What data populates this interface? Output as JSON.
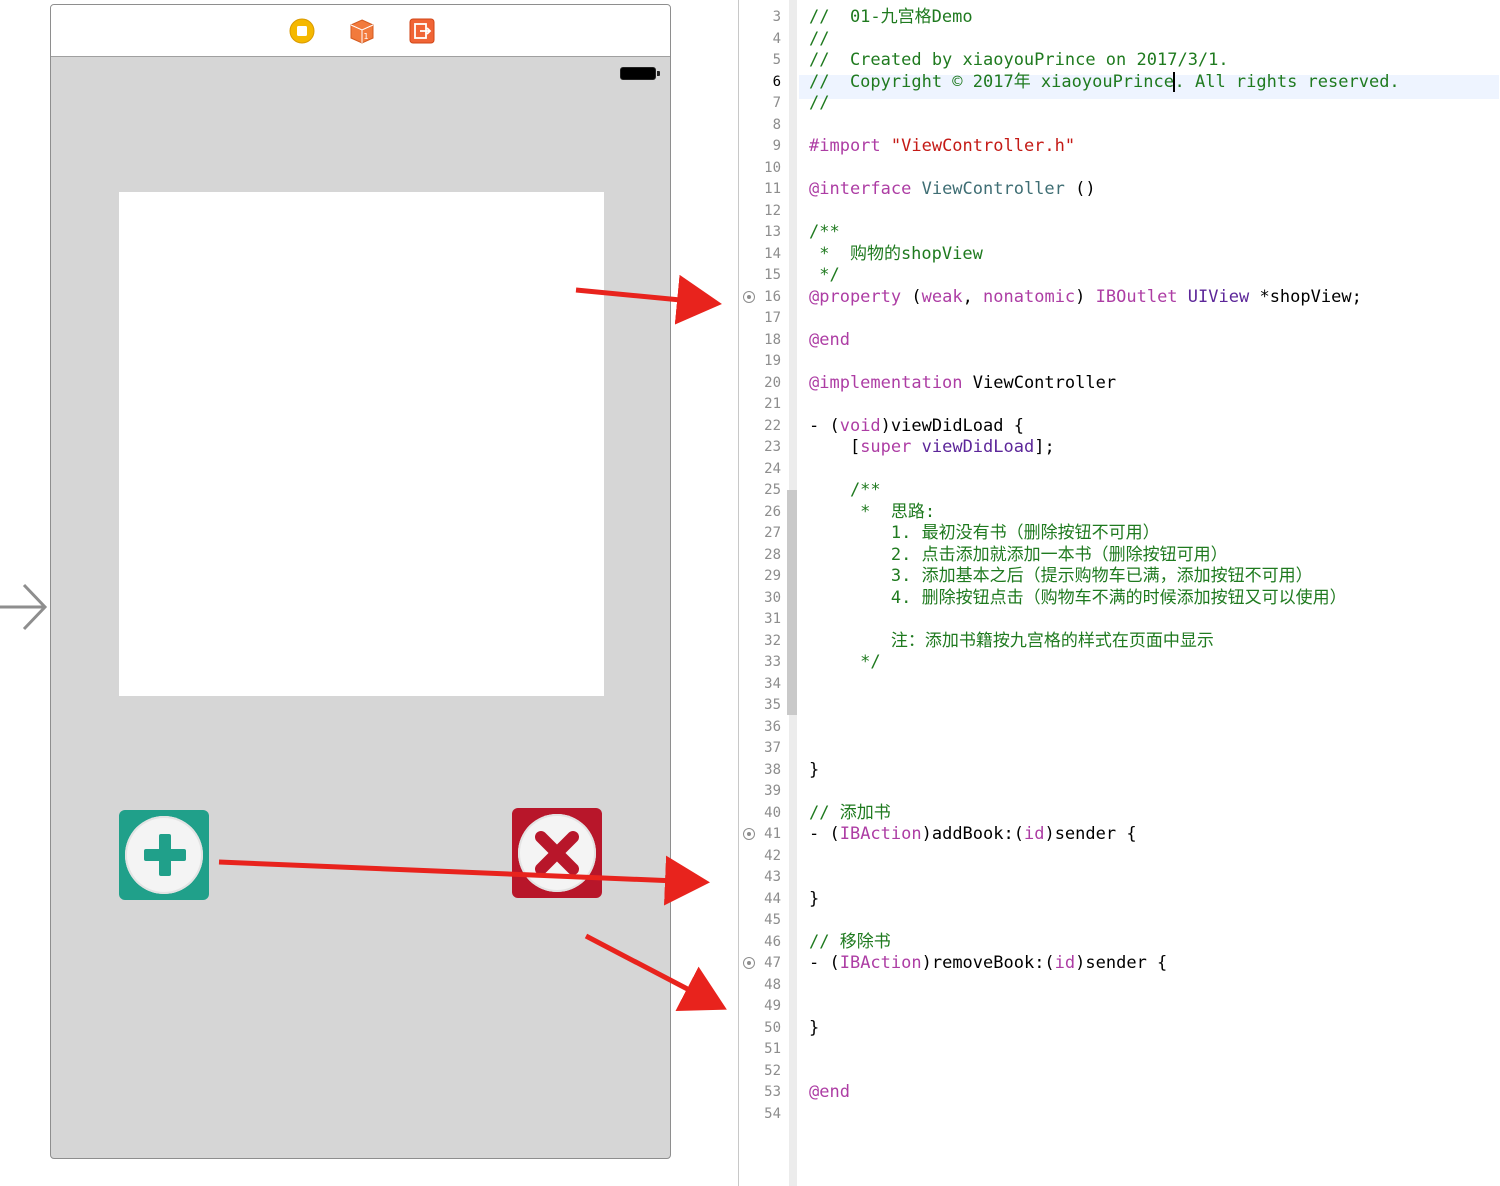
{
  "storyboard": {
    "dock_icons": [
      "view-controller-icon",
      "first-responder-icon",
      "exit-icon"
    ],
    "buttons": {
      "add": {
        "icon": "plus-icon",
        "color": "#20a08a"
      },
      "remove": {
        "icon": "cross-icon",
        "color": "#b8162a"
      }
    },
    "arrow_color": "#e8231d"
  },
  "editor": {
    "current_line": 6,
    "lines": [
      {
        "n": "3",
        "text": "//  01-九宫格Demo"
      },
      {
        "n": "4",
        "text": "//"
      },
      {
        "n": "5",
        "text": "//  Created by xiaoyouPrince on 2017/3/1."
      },
      {
        "n": "6",
        "text_a": "//  Copyright © 2017年 xiaoyouPrince",
        "text_b": ". All rights reserved."
      },
      {
        "n": "7",
        "text": "//"
      },
      {
        "n": "8",
        "text": ""
      },
      {
        "n": "9",
        "a": "#import ",
        "b": "\"ViewController.h\""
      },
      {
        "n": "10",
        "text": ""
      },
      {
        "n": "11",
        "a": "@interface",
        "b": " ViewController",
        "c": " ()"
      },
      {
        "n": "12",
        "text": ""
      },
      {
        "n": "13",
        "text": "/**"
      },
      {
        "n": "14",
        "text": " *  购物的shopView"
      },
      {
        "n": "15",
        "text": " */"
      },
      {
        "n": "16",
        "a": "@property",
        "b": " (",
        "c": "weak",
        "d": ", ",
        "e": "nonatomic",
        "f": ") ",
        "g": "IBOutlet",
        "h": " ",
        "i": "UIView",
        "j": " *shopView;"
      },
      {
        "n": "17",
        "text": ""
      },
      {
        "n": "18",
        "text": "@end"
      },
      {
        "n": "19",
        "text": ""
      },
      {
        "n": "20",
        "a": "@implementation",
        "b": " ViewController"
      },
      {
        "n": "21",
        "text": ""
      },
      {
        "n": "22",
        "a": "- (",
        "b": "void",
        "c": ")viewDidLoad {"
      },
      {
        "n": "23",
        "a": "    [",
        "b": "super",
        "c": " ",
        "d": "viewDidLoad",
        "e": "];"
      },
      {
        "n": "24",
        "text": ""
      },
      {
        "n": "25",
        "text": "    /**"
      },
      {
        "n": "26",
        "text": "     *  思路:"
      },
      {
        "n": "27",
        "text": "        1. 最初没有书（删除按钮不可用）"
      },
      {
        "n": "28",
        "text": "        2. 点击添加就添加一本书（删除按钮可用）"
      },
      {
        "n": "29",
        "text": "        3. 添加基本之后（提示购物车已满，添加按钮不可用）"
      },
      {
        "n": "30",
        "text": "        4. 删除按钮点击（购物车不满的时候添加按钮又可以使用）"
      },
      {
        "n": "31",
        "text": ""
      },
      {
        "n": "32",
        "text": "        注：添加书籍按九宫格的样式在页面中显示"
      },
      {
        "n": "33",
        "text": "     */"
      },
      {
        "n": "34",
        "text": ""
      },
      {
        "n": "35",
        "text": ""
      },
      {
        "n": "36",
        "text": ""
      },
      {
        "n": "37",
        "text": ""
      },
      {
        "n": "38",
        "text": "}"
      },
      {
        "n": "39",
        "text": ""
      },
      {
        "n": "40",
        "text": "// 添加书"
      },
      {
        "n": "41",
        "a": "- (",
        "b": "IBAction",
        "c": ")addBook:(",
        "d": "id",
        "e": ")sender {"
      },
      {
        "n": "42",
        "text": ""
      },
      {
        "n": "43",
        "text": ""
      },
      {
        "n": "44",
        "text": "}"
      },
      {
        "n": "45",
        "text": ""
      },
      {
        "n": "46",
        "text": "// 移除书"
      },
      {
        "n": "47",
        "a": "- (",
        "b": "IBAction",
        "c": ")removeBook:(",
        "d": "id",
        "e": ")sender {"
      },
      {
        "n": "48",
        "text": ""
      },
      {
        "n": "49",
        "text": ""
      },
      {
        "n": "50",
        "text": "}"
      },
      {
        "n": "51",
        "text": ""
      },
      {
        "n": "52",
        "text": ""
      },
      {
        "n": "53",
        "text": "@end"
      },
      {
        "n": "54",
        "text": ""
      }
    ]
  }
}
